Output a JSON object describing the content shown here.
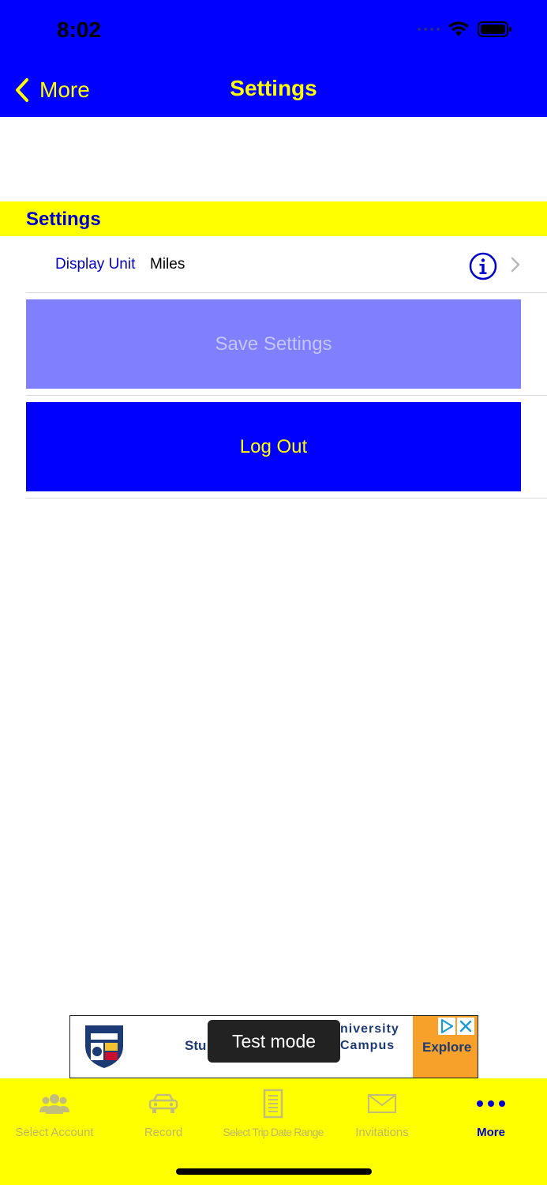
{
  "status_bar": {
    "time": "8:02"
  },
  "nav": {
    "back_label": "More",
    "title": "Settings"
  },
  "section": {
    "header": "Settings"
  },
  "settings_row": {
    "label": "Display Unit",
    "value": "Miles"
  },
  "buttons": {
    "save_label": "Save Settings",
    "logout_label": "Log Out"
  },
  "ad": {
    "text_left": "Stu",
    "text_right_line1": "niversity",
    "text_right_line2": "Campus",
    "cta": "Explore"
  },
  "toast": {
    "text": "Test mode"
  },
  "tabs": [
    {
      "label": "Select Account",
      "icon": "people-icon",
      "active": false
    },
    {
      "label": "Record",
      "icon": "car-icon",
      "active": false
    },
    {
      "label": "Select Trip Date Range",
      "icon": "document-icon",
      "active": false
    },
    {
      "label": "Invitations",
      "icon": "envelope-icon",
      "active": false
    },
    {
      "label": "More",
      "icon": "more-dots-icon",
      "active": true
    }
  ],
  "colors": {
    "brand_blue": "#0000ff",
    "brand_yellow": "#ffff00",
    "disabled_blue": "#8080ff",
    "label_blue": "#0000cc"
  }
}
